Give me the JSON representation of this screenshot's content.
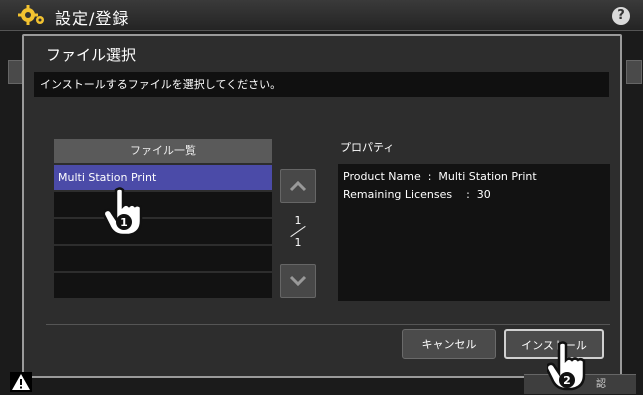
{
  "header": {
    "title": "設定/登録",
    "help_label": "?"
  },
  "dialog": {
    "title": "ファイル選択",
    "instruction": "インストールするファイルを選択してください。",
    "file_list": {
      "header": "ファイル一覧",
      "items": [
        "Multi Station Print",
        "",
        "",
        "",
        ""
      ],
      "selected_index": 0
    },
    "pagination": {
      "current": "1",
      "total": "1"
    },
    "properties": {
      "label": "プロパティ",
      "lines": [
        "Product Name  :  Multi Station Print",
        "Remaining Licenses    :  30"
      ]
    },
    "buttons": {
      "cancel": "キャンセル",
      "install": "インストール"
    }
  },
  "footer": {
    "partial_button_label": "認"
  },
  "callouts": [
    "1",
    "2"
  ],
  "colors": {
    "selected_row": "#4b4ba8",
    "background": "#2d2d2d"
  }
}
